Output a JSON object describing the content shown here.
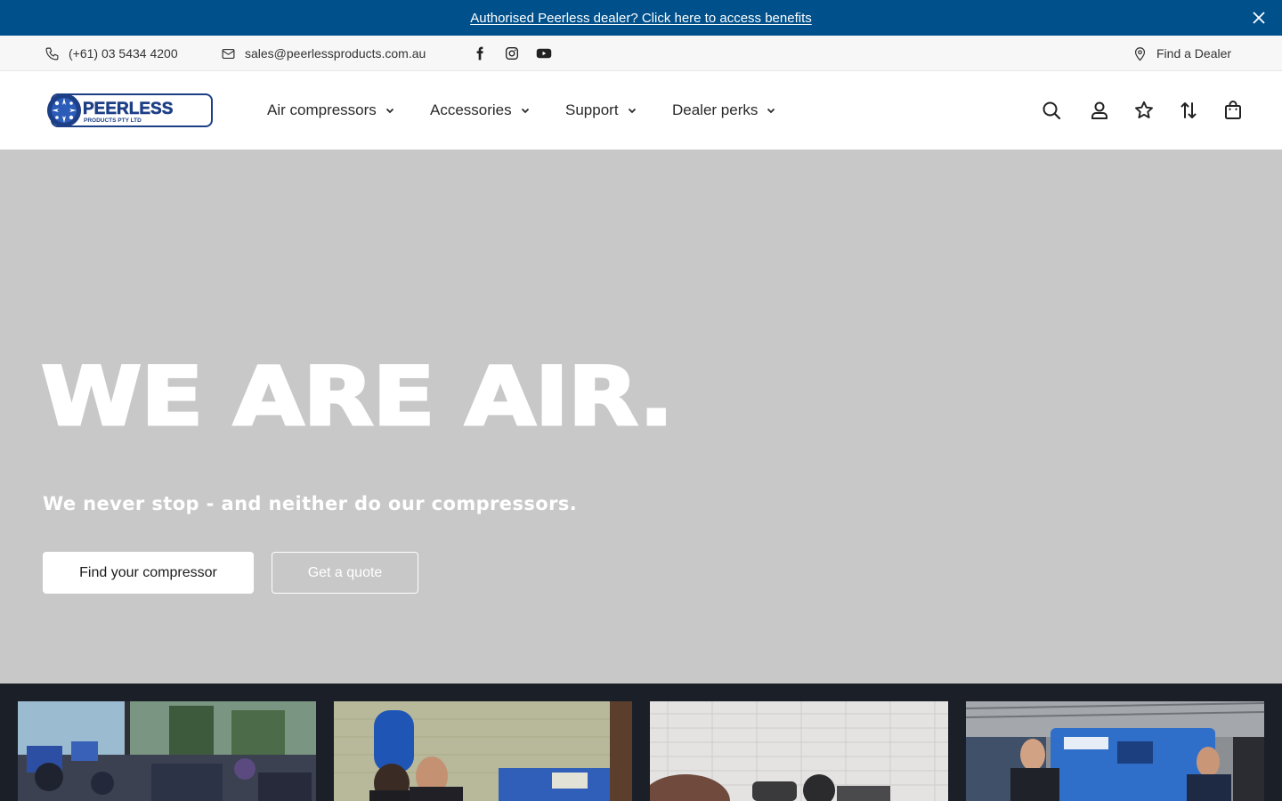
{
  "announcement": {
    "link_text": "Authorised Peerless dealer? Click here to access benefits",
    "bg_color": "#00508c"
  },
  "utility": {
    "phone": "(+61) 03 5434 4200",
    "email": "sales@peerlessproducts.com.au",
    "social": [
      "facebook-icon",
      "instagram-icon",
      "youtube-icon"
    ],
    "find_dealer": "Find a Dealer"
  },
  "logo": {
    "brand": "PEERLESS",
    "tagline": "PRODUCTS PTY LTD"
  },
  "nav": {
    "items": [
      {
        "label": "Air compressors"
      },
      {
        "label": "Accessories"
      },
      {
        "label": "Support"
      },
      {
        "label": "Dealer perks"
      }
    ]
  },
  "header_icons": [
    "search-icon",
    "account-icon",
    "wishlist-star-icon",
    "compare-icon",
    "cart-bag-icon"
  ],
  "hero": {
    "title": "WE ARE AIR.",
    "subtitle": "We never stop - and neither do our compressors.",
    "primary_cta": "Find your compressor",
    "secondary_cta": "Get a quote",
    "bg_color": "#c8c8c8"
  },
  "cards": [
    {
      "image": "showroom-compressors-photo"
    },
    {
      "image": "team-with-blue-compressor-photo"
    },
    {
      "image": "workshop-compressor-photo"
    },
    {
      "image": "staff-with-portable-compressor-photo"
    }
  ]
}
